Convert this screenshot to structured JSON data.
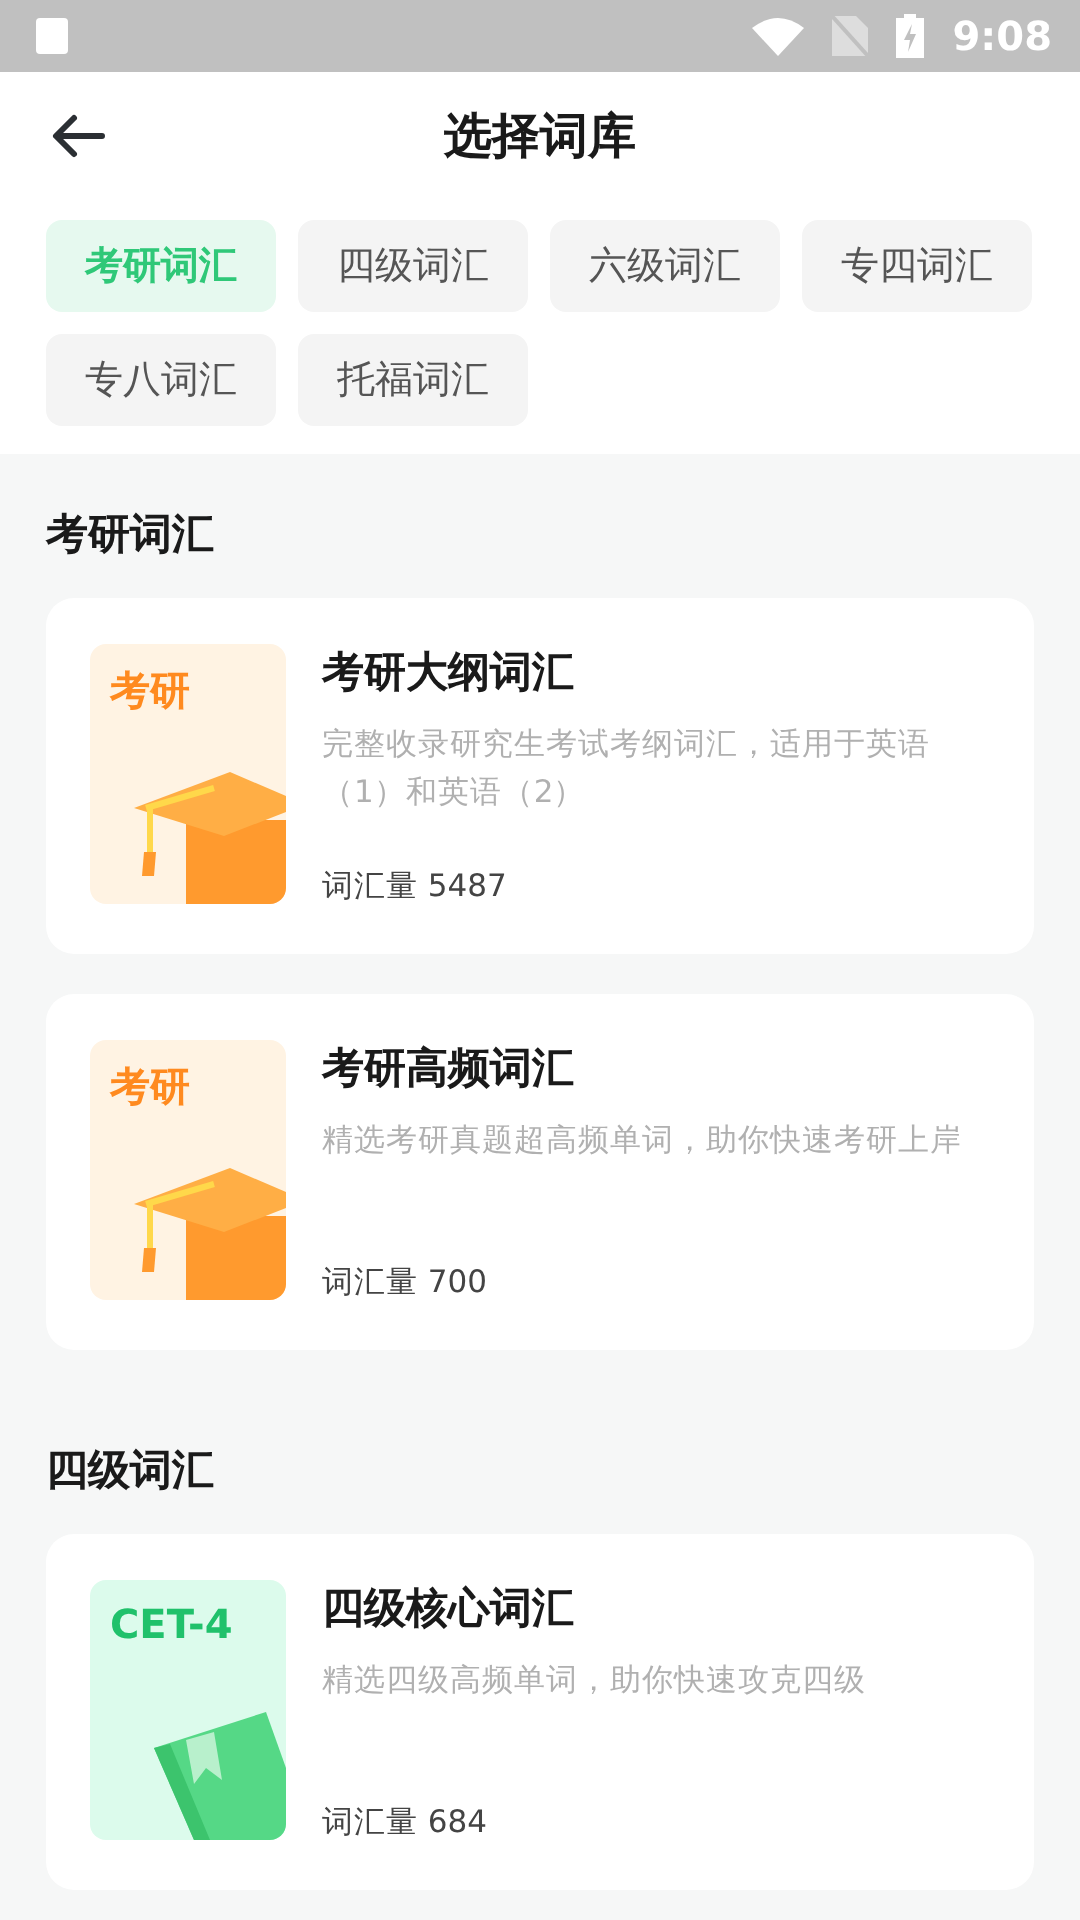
{
  "status_bar": {
    "time": "9:08"
  },
  "header": {
    "title": "选择词库"
  },
  "tabs": [
    {
      "label": "考研词汇",
      "selected": true
    },
    {
      "label": "四级词汇",
      "selected": false
    },
    {
      "label": "六级词汇",
      "selected": false
    },
    {
      "label": "专四词汇",
      "selected": false
    },
    {
      "label": "专八词汇",
      "selected": false
    },
    {
      "label": "托福词汇",
      "selected": false
    }
  ],
  "sections": [
    {
      "title": "考研词汇",
      "books": [
        {
          "kind": "cap",
          "cover_label": "考研",
          "title": "考研大纲词汇",
          "description": "完整收录研究生考试考纲词汇，适用于英语（1）和英语（2）",
          "count": "词汇量 5487"
        },
        {
          "kind": "cap",
          "cover_label": "考研",
          "title": "考研高频词汇",
          "description": "精选考研真题超高频单词，助你快速考研上岸",
          "count": "词汇量 700"
        }
      ]
    },
    {
      "title": "四级词汇",
      "books": [
        {
          "kind": "book",
          "cover_label": "CET-4",
          "title": "四级核心词汇",
          "description": "精选四级高频单词，助你快速攻克四级",
          "count": "词汇量 684"
        }
      ]
    }
  ]
}
